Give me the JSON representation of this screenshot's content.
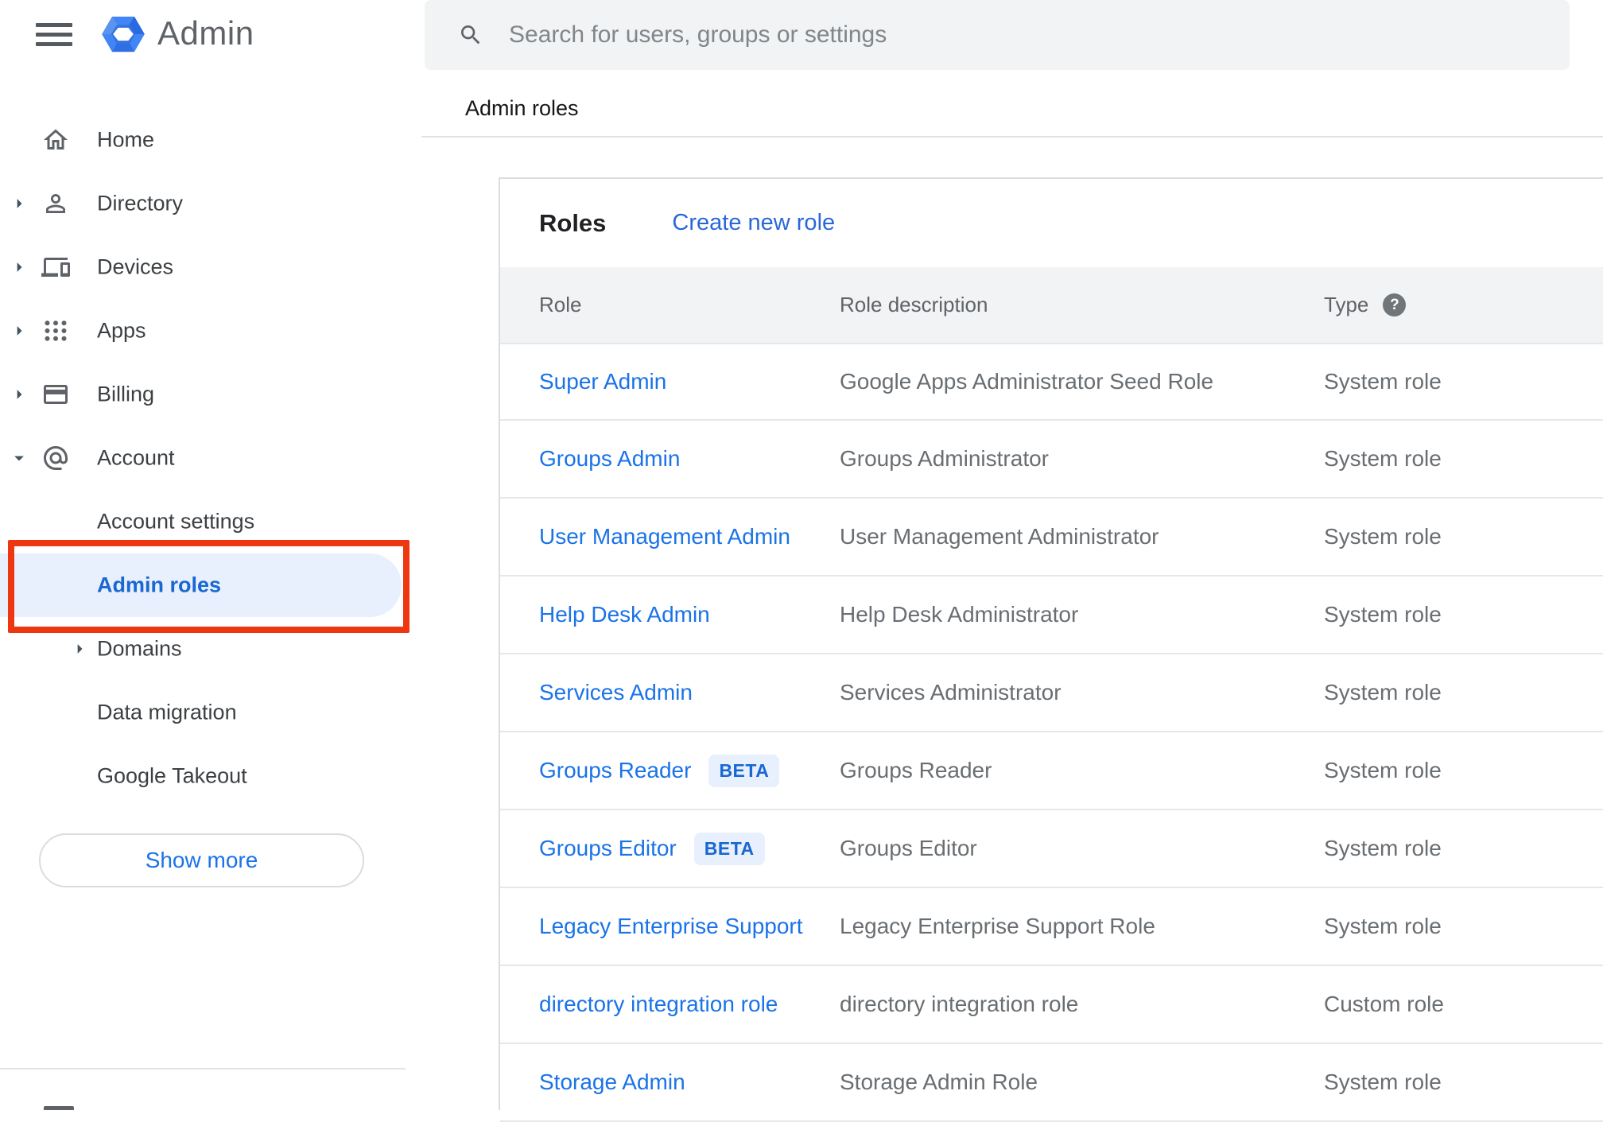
{
  "app": {
    "title": "Admin"
  },
  "search": {
    "placeholder": "Search for users, groups or settings"
  },
  "sidebar": {
    "items": [
      {
        "label": "Home",
        "icon": "home-icon",
        "arrow": null
      },
      {
        "label": "Directory",
        "icon": "person-icon",
        "arrow": "right"
      },
      {
        "label": "Devices",
        "icon": "devices-icon",
        "arrow": "right"
      },
      {
        "label": "Apps",
        "icon": "apps-icon",
        "arrow": "right"
      },
      {
        "label": "Billing",
        "icon": "billing-icon",
        "arrow": "right"
      },
      {
        "label": "Account",
        "icon": "at-icon",
        "arrow": "down",
        "expanded": true
      }
    ],
    "account_subitems": [
      {
        "label": "Account settings"
      },
      {
        "label": "Admin roles",
        "selected": true,
        "annotated": true
      },
      {
        "label": "Domains",
        "arrow": "right"
      },
      {
        "label": "Data migration"
      },
      {
        "label": "Google Takeout"
      }
    ],
    "show_more_label": "Show more"
  },
  "breadcrumb": "Admin roles",
  "roles_panel": {
    "title": "Roles",
    "create_link": "Create new role",
    "columns": [
      "Role",
      "Role description",
      "Type"
    ],
    "beta_label": "BETA",
    "rows": [
      {
        "role": "Super Admin",
        "beta": false,
        "description": "Google Apps Administrator Seed Role",
        "type": "System role"
      },
      {
        "role": "Groups Admin",
        "beta": false,
        "description": "Groups Administrator",
        "type": "System role"
      },
      {
        "role": "User Management Admin",
        "beta": false,
        "description": "User Management Administrator",
        "type": "System role"
      },
      {
        "role": "Help Desk Admin",
        "beta": false,
        "description": "Help Desk Administrator",
        "type": "System role"
      },
      {
        "role": "Services Admin",
        "beta": false,
        "description": "Services Administrator",
        "type": "System role"
      },
      {
        "role": "Groups Reader",
        "beta": true,
        "description": "Groups Reader",
        "type": "System role"
      },
      {
        "role": "Groups Editor",
        "beta": true,
        "description": "Groups Editor",
        "type": "System role"
      },
      {
        "role": "Legacy Enterprise Support",
        "beta": false,
        "description": "Legacy Enterprise Support Role",
        "type": "System role"
      },
      {
        "role": "directory integration role",
        "beta": false,
        "description": "directory integration role",
        "type": "Custom role"
      },
      {
        "role": "Storage Admin",
        "beta": false,
        "description": "Storage Admin Role",
        "type": "System role"
      }
    ]
  },
  "colors": {
    "link_blue": "#1a73e8",
    "selected_blue": "#1967d2",
    "selected_bg": "#e8f0fe",
    "annotation_red": "#ee3611",
    "header_band": "#f1f3f4",
    "logo_blue": "#4285f4"
  }
}
